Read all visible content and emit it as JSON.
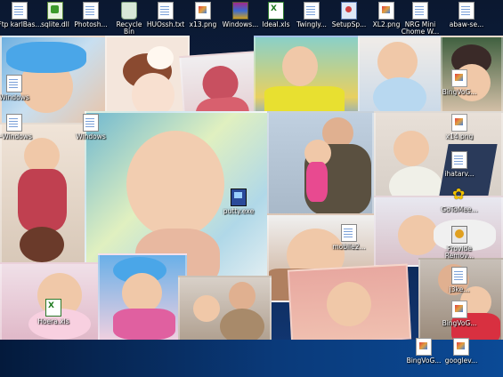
{
  "desktop": {
    "top_icons": [
      {
        "label": "Ftp karlBas...",
        "icon": "ftp-icon"
      },
      {
        "label": "sqlite.dll",
        "icon": "dll-icon"
      },
      {
        "label": "Photosh...",
        "icon": "doc-icon"
      },
      {
        "label": "Recycle Bin",
        "icon": "recycle-bin-icon"
      },
      {
        "label": "HUOssh.txt",
        "icon": "text-file-icon"
      },
      {
        "label": "x13.png",
        "icon": "png-icon"
      },
      {
        "label": "Windows...",
        "icon": "archive-icon"
      },
      {
        "label": "Ideal.xls",
        "icon": "excel-icon"
      },
      {
        "label": "Twingly...",
        "icon": "doc-icon"
      },
      {
        "label": "SetupSp...",
        "icon": "setup-icon"
      },
      {
        "label": "XL2.png",
        "icon": "png-icon"
      },
      {
        "label": "NRG Mini Chome W...",
        "icon": "doc-icon"
      },
      {
        "label": "abaw-se...",
        "icon": "doc-icon"
      }
    ],
    "left_icons": [
      {
        "label": "Windows",
        "icon": "doc-icon"
      },
      {
        "label": "~Windows",
        "icon": "doc-icon"
      },
      {
        "label": "Windows",
        "icon": "doc-icon"
      }
    ],
    "mid_icons": [
      {
        "label": "putty.exe",
        "icon": "putty-icon"
      },
      {
        "label": "mobile2...",
        "icon": "doc-icon"
      },
      {
        "label": "Hoera.xls",
        "icon": "excel-icon"
      }
    ],
    "right_icons": [
      {
        "label": "BingVoG...",
        "icon": "png-icon"
      },
      {
        "label": "x14.png",
        "icon": "png-icon"
      },
      {
        "label": "ihatarv...",
        "icon": "doc-icon"
      },
      {
        "label": "GoToMee...",
        "icon": "flower-icon"
      },
      {
        "label": "Provide Remov...",
        "icon": "remove-icon"
      },
      {
        "label": "j3ke...",
        "icon": "doc-icon"
      },
      {
        "label": "BingVoG...",
        "icon": "png-icon"
      }
    ],
    "bottom_icons": [
      {
        "label": "BingVoG...",
        "icon": "png-icon"
      },
      {
        "label": "googlev...",
        "icon": "png-icon"
      }
    ]
  }
}
